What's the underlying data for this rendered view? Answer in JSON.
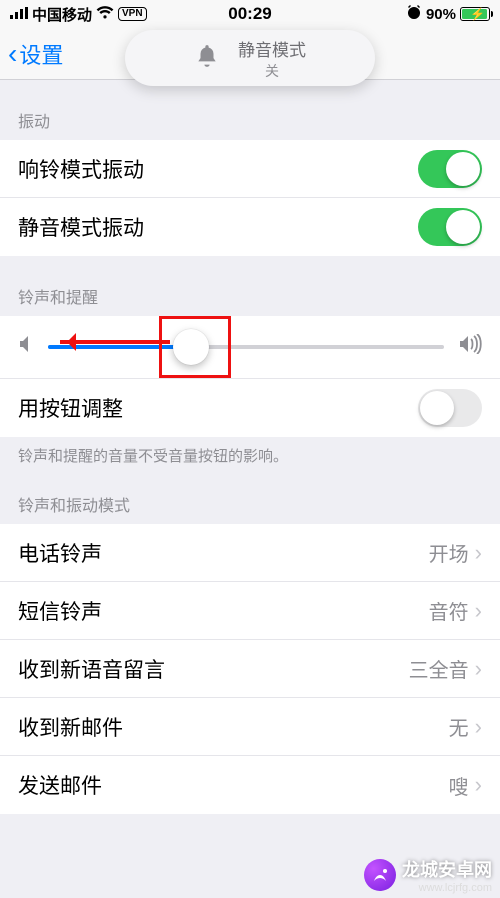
{
  "status": {
    "carrier": "中国移动",
    "vpn": "VPN",
    "time": "00:29",
    "battery_pct": "90%"
  },
  "nav": {
    "back_label": "设置"
  },
  "banner": {
    "title": "静音模式",
    "subtitle": "关"
  },
  "sections": {
    "vibrate_header": "振动",
    "vibrate_ring_label": "响铃模式振动",
    "vibrate_ring_on": true,
    "vibrate_silent_label": "静音模式振动",
    "vibrate_silent_on": true,
    "ringer_header": "铃声和提醒",
    "slider_pct": 36,
    "change_with_buttons_label": "用按钮调整",
    "change_with_buttons_on": false,
    "ringer_footer": "铃声和提醒的音量不受音量按钮的影响。",
    "patterns_header": "铃声和振动模式",
    "rows": {
      "ringtone": {
        "label": "电话铃声",
        "value": "开场"
      },
      "text_tone": {
        "label": "短信铃声",
        "value": "音符"
      },
      "new_voicemail": {
        "label": "收到新语音留言",
        "value": "三全音"
      },
      "new_mail": {
        "label": "收到新邮件",
        "value": "无"
      },
      "sent_mail": {
        "label": "发送邮件",
        "value": "嗖"
      }
    }
  },
  "watermark": {
    "name": "龙城安卓网",
    "domain": "www.lcjrfg.com"
  }
}
